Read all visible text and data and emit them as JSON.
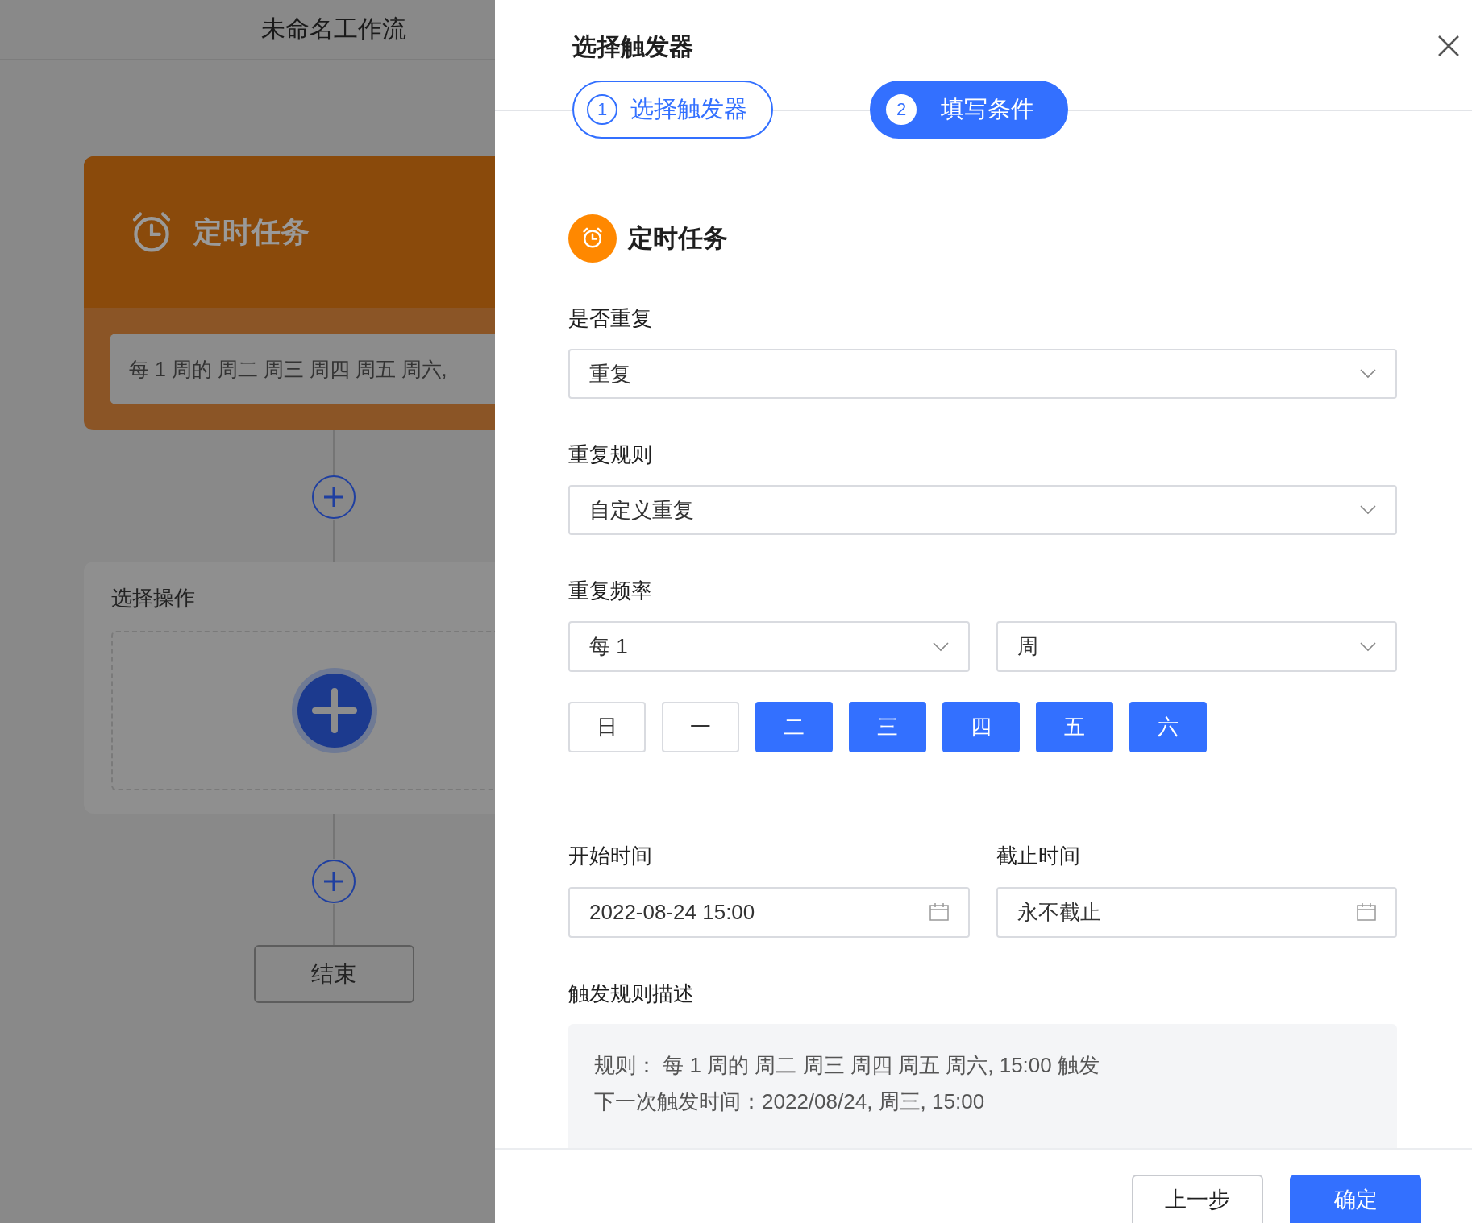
{
  "canvas": {
    "title": "未命名工作流",
    "trigger_card": {
      "title": "定时任务",
      "summary": "每 1 周的 周二 周三 周四 周五 周六,"
    },
    "action_card": {
      "title": "选择操作"
    },
    "end_node": "结束"
  },
  "drawer": {
    "title": "选择触发器",
    "steps": [
      {
        "number": "1",
        "label": "选择触发器",
        "selected": false
      },
      {
        "number": "2",
        "label": "填写条件",
        "selected": true
      }
    ],
    "trigger": {
      "name": "定时任务"
    },
    "repeat": {
      "label": "是否重复",
      "value": "重复"
    },
    "rule": {
      "label": "重复规则",
      "value": "自定义重复"
    },
    "frequency": {
      "label": "重复频率",
      "interval": "每 1",
      "unit": "周"
    },
    "weekdays": [
      {
        "label": "日",
        "selected": false
      },
      {
        "label": "一",
        "selected": false
      },
      {
        "label": "二",
        "selected": true
      },
      {
        "label": "三",
        "selected": true
      },
      {
        "label": "四",
        "selected": true
      },
      {
        "label": "五",
        "selected": true
      },
      {
        "label": "六",
        "selected": true
      }
    ],
    "start_time": {
      "label": "开始时间",
      "value": "2022-08-24 15:00"
    },
    "end_time": {
      "label": "截止时间",
      "value": "永不截止"
    },
    "description": {
      "label": "触发规则描述",
      "lines": [
        "规则： 每 1 周的 周二 周三 周四 周五 周六, 15:00 触发",
        "下一次触发时间：2022/08/24, 周三, 15:00"
      ]
    },
    "buttons": [
      {
        "label": "上一步",
        "kind": "secondary"
      },
      {
        "label": "确定",
        "kind": "primary"
      }
    ]
  }
}
